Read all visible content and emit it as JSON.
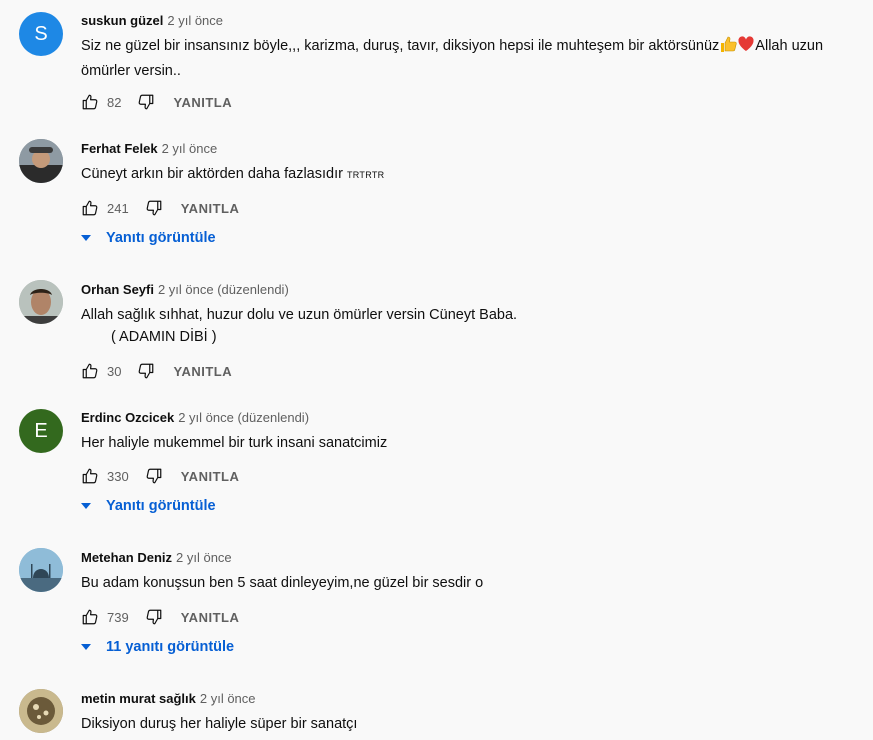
{
  "comments": [
    {
      "author": "suskun güzel",
      "time": "2 yıl önce",
      "avatar_letter": "S",
      "avatar_color": "#1e88e5",
      "text_lines": [
        "Siz ne güzel bir insansınız böyle,,, karizma, duruş, tavır, diksiyon hepsi ile muhteşem bir aktörsünüz",
        "Allah uzun",
        "ömürler versin.."
      ],
      "emojis": [
        "thumbs-up-emoji",
        "heart-emoji"
      ],
      "likes": "82",
      "reply_label": "YANITLA"
    },
    {
      "author": "Ferhat Felek",
      "time": "2 yıl önce",
      "text": "Cüneyt arkın bir aktörden daha fazlasıdır",
      "text_small": "TRTRTR",
      "likes": "241",
      "reply_label": "YANITLA",
      "view_replies": "Yanıtı görüntüle"
    },
    {
      "author": "Orhan Seyfi",
      "time": "2 yıl önce (düzenlendi)",
      "text_lines": [
        "Allah sağlık sıhhat, huzur dolu ve uzun ömürler versin Cüneyt Baba.",
        "( ADAMIN DİBİ )"
      ],
      "likes": "30",
      "reply_label": "YANITLA"
    },
    {
      "author": "Erdinc Ozcicek",
      "time": "2 yıl önce (düzenlendi)",
      "avatar_letter": "E",
      "avatar_color": "#33691e",
      "text": "Her haliyle mukemmel bir turk insani sanatcimiz",
      "likes": "330",
      "reply_label": "YANITLA",
      "view_replies": "Yanıtı görüntüle"
    },
    {
      "author": "Metehan Deniz",
      "time": "2 yıl önce",
      "text": "Bu adam konuşsun ben 5 saat dinleyeyim,ne güzel bir sesdir o",
      "likes": "739",
      "reply_label": "YANITLA",
      "view_replies": "11 yanıtı görüntüle"
    },
    {
      "author": "metin murat sağlık",
      "time": "2 yıl önce",
      "text": "Diksiyon duruş her haliyle süper bir sanatçı"
    }
  ],
  "colors": {
    "link": "#065fd4",
    "secondary_text": "#606060",
    "background": "#f9f9f9"
  }
}
